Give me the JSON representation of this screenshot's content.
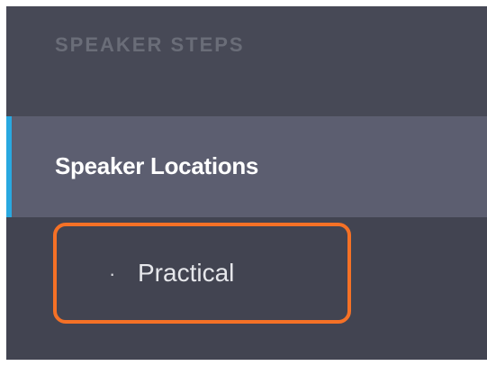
{
  "sidebar": {
    "section_title": "SPEAKER STEPS",
    "items": [
      {
        "label": "Speaker Locations",
        "active": true,
        "children": [
          {
            "label": "Practical",
            "bullet": "·"
          }
        ]
      }
    ]
  },
  "colors": {
    "sidebar_bg": "#424451",
    "active_bg": "#5c5e70",
    "active_indicator": "#29a8e0",
    "highlight_outline": "#f57126"
  }
}
